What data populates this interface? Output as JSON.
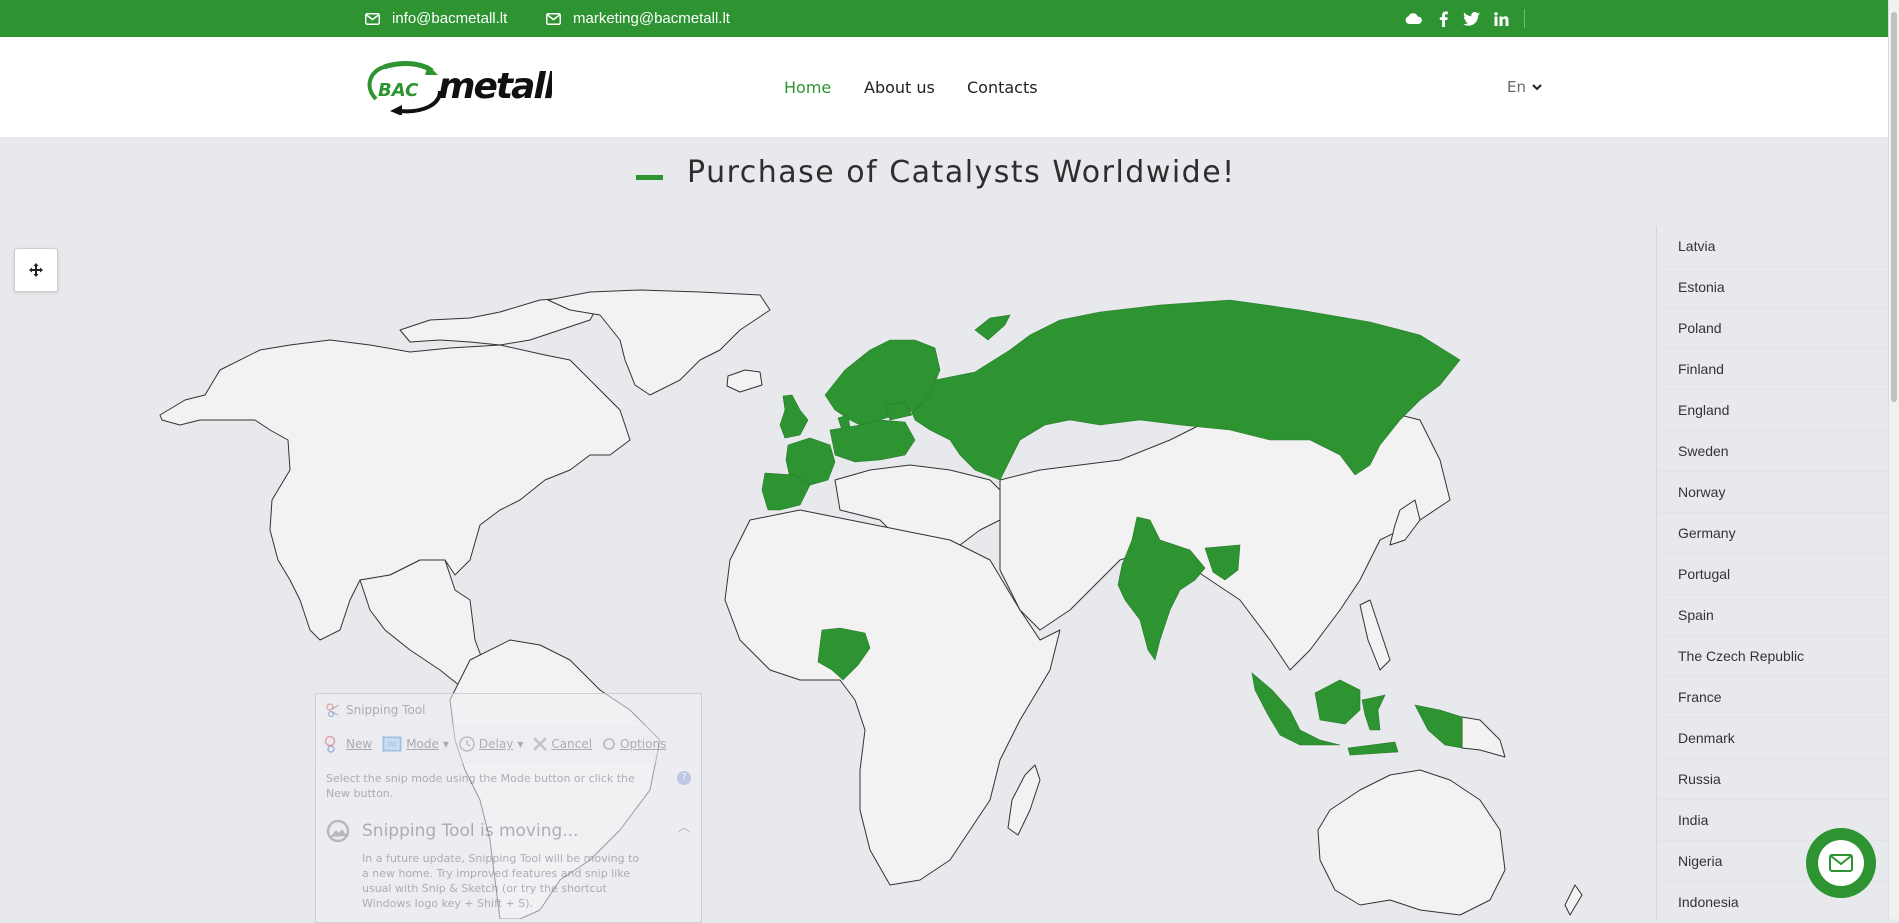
{
  "topbar": {
    "emails": [
      {
        "icon": "envelope-icon",
        "text": "info@bacmetall.lt"
      },
      {
        "icon": "envelope-icon",
        "text": "marketing@bacmetall.lt"
      }
    ],
    "social": [
      "cloud-icon",
      "facebook-icon",
      "twitter-icon",
      "linkedin-icon"
    ]
  },
  "header": {
    "logo": {
      "left": "BAC",
      "right": "metall"
    },
    "nav": [
      {
        "label": "Home",
        "active": true
      },
      {
        "label": "About us",
        "active": false
      },
      {
        "label": "Contacts",
        "active": false
      }
    ],
    "language": "En"
  },
  "page": {
    "title": "Purchase of Catalysts Worldwide!"
  },
  "map": {
    "move_control_icon": "move-arrows-icon",
    "highlighted_countries": [
      "Latvia",
      "Estonia",
      "Poland",
      "Finland",
      "England",
      "Sweden",
      "Norway",
      "Germany",
      "Portugal",
      "Spain",
      "The Czech Republic",
      "France",
      "Denmark",
      "Russia",
      "India",
      "Nigeria",
      "Indonesia"
    ],
    "highlight_color": "#2d9431",
    "land_color": "#f2f2f3",
    "water_color": "#e8e9ed"
  },
  "country_list": [
    "Latvia",
    "Estonia",
    "Poland",
    "Finland",
    "England",
    "Sweden",
    "Norway",
    "Germany",
    "Portugal",
    "Spain",
    "The Czech Republic",
    "France",
    "Denmark",
    "Russia",
    "India",
    "Nigeria",
    "Indonesia"
  ],
  "chat_button": {
    "icon": "envelope-icon"
  },
  "snipping_tool": {
    "title": "Snipping Tool",
    "toolbar": {
      "new": "New",
      "mode": "Mode",
      "delay": "Delay",
      "cancel": "Cancel",
      "options": "Options"
    },
    "hint": "Select the snip mode using the Mode button or click the New button.",
    "notice_title": "Snipping Tool is moving...",
    "notice_body": "In a future update, Snipping Tool will be moving to a new home. Try improved features and snip like usual with Snip & Sketch (or try the shortcut Windows logo key + Shift + S)."
  },
  "colors": {
    "brand_green": "#2d9431",
    "background": "#e8e9ed",
    "text_dark": "#2e2e2e"
  }
}
